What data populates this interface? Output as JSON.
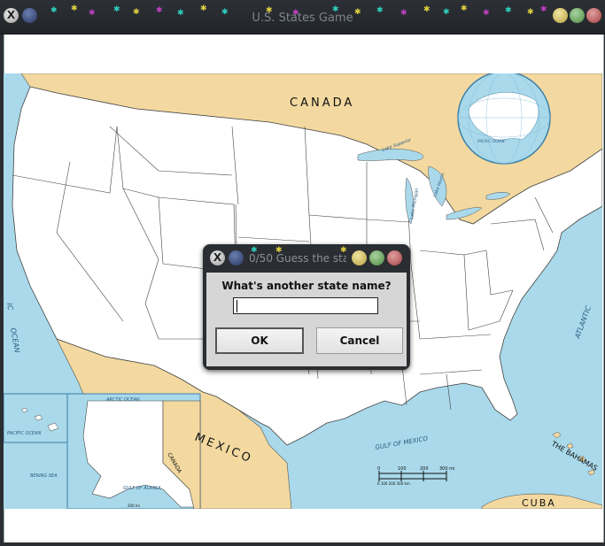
{
  "window": {
    "title": "U.S. States Game"
  },
  "map": {
    "labels": {
      "canada": "CANADA",
      "mexico": "MEXICO",
      "gulf_of_mexico": "GULF OF MEXICO",
      "atlantic": "ATLANTIC",
      "pacific_ocean": "OCEAN",
      "pacific_letters": "IC",
      "the_bahamas": "THE BAHAMAS",
      "cuba": "CUBA",
      "lake_superior": "Lake Superior",
      "lake_michigan": "Lake Michigan",
      "lake_huron": "Lake Huron",
      "arctic_ocean": "ARCTIC OCEAN",
      "pacific_inset": "PACIFIC OCEAN",
      "gulf_of_alaska": "GULF OF ALASKA",
      "bering_sea": "BERING SEA",
      "canada_inset": "CANADA",
      "globe_ocean": "PACIFIC OCEAN",
      "scale_0": "0",
      "scale_100": "100",
      "scale_200": "200",
      "scale_300mi": "300 mi",
      "scale_km": "0 100 200 300 km",
      "inset_scale": "200 mi"
    }
  },
  "dialog": {
    "title": "0/50 Guess the sta",
    "prompt": "What's another state name?",
    "input_value": "",
    "ok_label": "OK",
    "cancel_label": "Cancel"
  },
  "colors": {
    "water": "#a9d9ea",
    "land_foreign": "#f3d9a0",
    "land_us": "#ffffff",
    "titlebar": "#2c3036"
  }
}
